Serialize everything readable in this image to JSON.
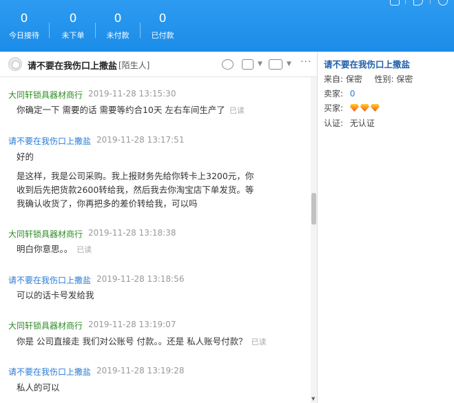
{
  "stats": [
    {
      "value": "0",
      "label": "今日接待"
    },
    {
      "value": "0",
      "label": "未下单"
    },
    {
      "value": "0",
      "label": "未付款"
    },
    {
      "value": "0",
      "label": "已付款"
    }
  ],
  "toolbar_icons": [
    "note-icon",
    "speaker-icon",
    "help-icon"
  ],
  "chat": {
    "title": "请不要在我伤口上撒盐",
    "tag": "[陌生人]",
    "header_icons": [
      "user-search-icon",
      "transfer-icon",
      "video-icon",
      "more-icon"
    ]
  },
  "messages": [
    {
      "sender": "大同轩锁具器材商行",
      "role": "seller",
      "time": "2019-11-28 13:15:30",
      "lines": [
        "你确定一下   需要的话 需要等约合10天 左右车间生产了"
      ],
      "read": "已读"
    },
    {
      "sender": "请不要在我伤口上撒盐",
      "role": "buyer",
      "time": "2019-11-28 13:17:51",
      "lines": [
        "好的",
        "",
        "是这样，我是公司采购。我上报财务先给你转卡上3200元，你",
        "收到后先把货款2600转给我，然后我去你淘宝店下单发货。等",
        "我确认收货了，你再把多的差价转给我，可以吗"
      ],
      "read": ""
    },
    {
      "sender": "大同轩锁具器材商行",
      "role": "seller",
      "time": "2019-11-28 13:18:38",
      "lines": [
        "明白你意思。。"
      ],
      "read": "已读"
    },
    {
      "sender": "请不要在我伤口上撒盐",
      "role": "buyer",
      "time": "2019-11-28 13:18:56",
      "lines": [
        "可以的话卡号发给我"
      ],
      "read": ""
    },
    {
      "sender": "大同轩锁具器材商行",
      "role": "seller",
      "time": "2019-11-28 13:19:07",
      "lines": [
        "你是 公司直接走 我们对公账号 付款。。还是 私人账号付款？"
      ],
      "read": "已读"
    },
    {
      "sender": "请不要在我伤口上撒盐",
      "role": "buyer",
      "time": "2019-11-28 13:19:28",
      "lines": [
        "私人的可以"
      ],
      "read": ""
    }
  ],
  "info": {
    "name": "请不要在我伤口上撒盐",
    "from_label": "来自:",
    "from_value": "保密",
    "gender_label": "性别:",
    "gender_value": "保密",
    "seller_label": "卖家:",
    "seller_value": "0",
    "buyer_label": "买家:",
    "buyer_level": 3,
    "auth_label": "认证:",
    "auth_value": "无认证"
  },
  "colors": {
    "topbar": "#1b8ce8",
    "seller_name": "#2e8b24",
    "buyer_name": "#2a7bd4",
    "panel_name": "#1f5ea8"
  }
}
